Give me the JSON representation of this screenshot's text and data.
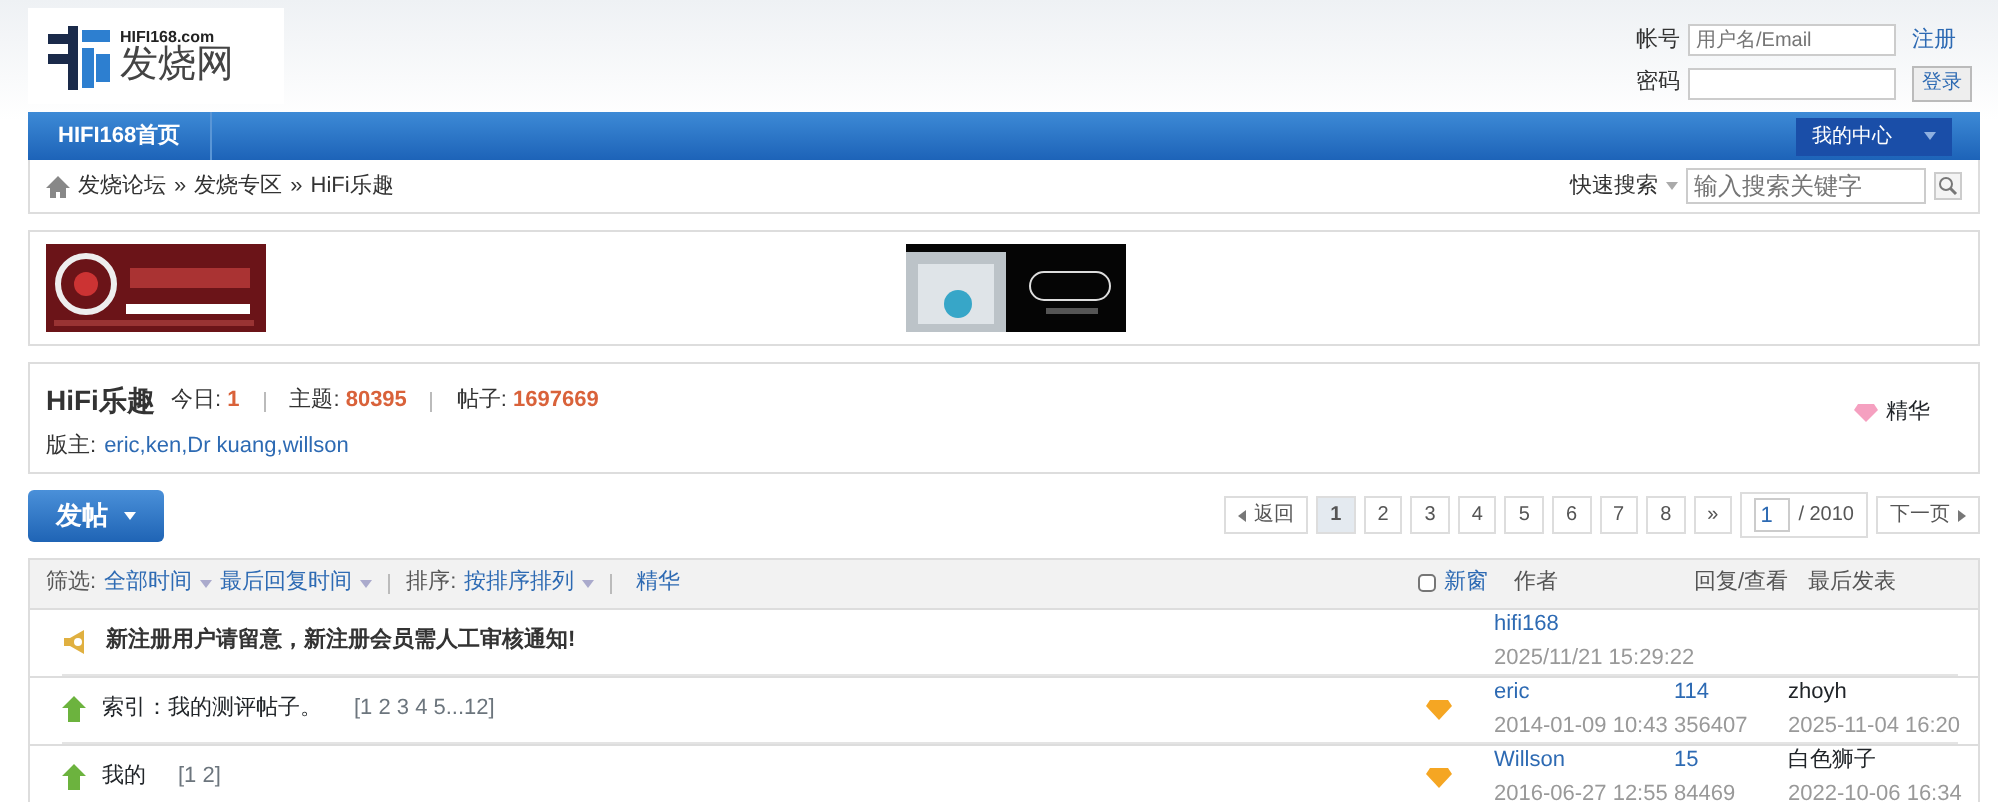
{
  "logo": {
    "domain": "HIFI168.com",
    "name": "发烧网"
  },
  "login": {
    "account_label": "帐号",
    "account_placeholder": "用户名/Email",
    "register": "注册",
    "password_label": "密码",
    "login_button": "登录"
  },
  "navbar": {
    "home": "HIFI168首页",
    "my_center": "我的中心"
  },
  "breadcrumb": {
    "items": [
      "发烧论坛",
      "发烧专区",
      "HiFi乐趣"
    ],
    "separator": "»"
  },
  "quick_search": {
    "label": "快速搜索",
    "placeholder": "输入搜索关键字"
  },
  "forum": {
    "title": "HiFi乐趣",
    "stats": [
      {
        "label": "今日:",
        "value": "1"
      },
      {
        "label": "主题:",
        "value": "80395"
      },
      {
        "label": "帖子:",
        "value": "1697669"
      }
    ],
    "moderators_label": "版主:",
    "moderators": "eric,ken,Dr kuang,willson",
    "digest": "精华"
  },
  "post_button": "发帖",
  "pagination": {
    "back": "返回",
    "pages": [
      {
        "label": "1",
        "selected": true
      },
      {
        "label": "2",
        "selected": false
      },
      {
        "label": "3",
        "selected": false
      },
      {
        "label": "4",
        "selected": false
      },
      {
        "label": "5",
        "selected": false
      },
      {
        "label": "6",
        "selected": false
      },
      {
        "label": "7",
        "selected": false
      },
      {
        "label": "8",
        "selected": false
      }
    ],
    "more": "»",
    "current": "1",
    "total": "/ 2010",
    "next": "下一页"
  },
  "filter": {
    "label": "筛选:",
    "items": [
      "全部时间",
      "最后回复时间"
    ],
    "sort_label": "排序:",
    "sort": "按排序排列",
    "digest": "精华",
    "new_window": {
      "label": "新窗",
      "checked": false
    },
    "columns": [
      "作者",
      "回复/查看",
      "最后发表"
    ]
  },
  "threads": [
    {
      "kind": "announcement",
      "title": "新注册用户请留意，新注册会员需人工审核通知!",
      "author": "hifi168",
      "date": "2025/11/21 15:29:22"
    },
    {
      "kind": "pinned",
      "title": "索引：我的测评帖子。",
      "pages": "[1 2 3 4 5...12]",
      "digest": true,
      "author": "eric",
      "date": "2014-01-09 10:43",
      "replies": "114",
      "views": "356407",
      "last_user": "zhoyh",
      "last_date": "2025-11-04 16:20"
    },
    {
      "kind": "pinned",
      "title": "我的",
      "pages": "[1 2]",
      "digest": true,
      "author": "Willson",
      "date": "2016-06-27 12:55",
      "replies": "15",
      "views": "84469",
      "last_user": "白色狮子",
      "last_date": "2022-10-06 16:34"
    }
  ]
}
